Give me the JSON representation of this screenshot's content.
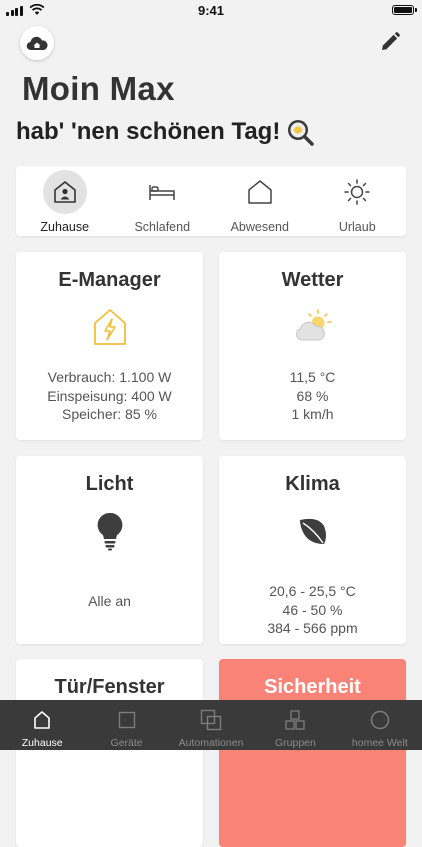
{
  "statusbar": {
    "time": "9:41"
  },
  "header": {
    "greeting": "Moin Max",
    "subgreeting": "hab' 'nen schönen Tag!"
  },
  "modes": [
    {
      "label": "Zuhause",
      "icon": "home-person-icon",
      "active": true
    },
    {
      "label": "Schlafend",
      "icon": "bed-icon",
      "active": false
    },
    {
      "label": "Abwesend",
      "icon": "house-outline-icon",
      "active": false
    },
    {
      "label": "Urlaub",
      "icon": "sun-icon",
      "active": false
    }
  ],
  "cards": {
    "emanager": {
      "title": "E-Manager",
      "icon": "lightning-house-icon",
      "lines": [
        "Verbrauch: 1.100 W",
        "Einspeisung: 400 W",
        "Speicher: 85 %"
      ]
    },
    "wetter": {
      "title": "Wetter",
      "icon": "sun-cloud-icon",
      "lines": [
        "11,5 °C",
        "68 %",
        "1 km/h"
      ]
    },
    "licht": {
      "title": "Licht",
      "icon": "lightbulb-icon",
      "lines": [
        "Alle an"
      ]
    },
    "klima": {
      "title": "Klima",
      "icon": "leaf-icon",
      "lines": [
        "20,6 - 25,5 °C",
        "46 - 50 %",
        "384 - 566 ppm"
      ]
    },
    "tuer": {
      "title": "Tür/Fenster"
    },
    "sicherheit": {
      "title": "Sicherheit",
      "color": "#fa8378"
    }
  },
  "bottomnav": [
    {
      "label": "Zuhause",
      "icon": "home-icon",
      "active": true
    },
    {
      "label": "Geräte",
      "icon": "square-icon",
      "active": false
    },
    {
      "label": "Automationen",
      "icon": "stacked-squares-icon",
      "active": false
    },
    {
      "label": "Gruppen",
      "icon": "grid-squares-icon",
      "active": false
    },
    {
      "label": "homee Welt",
      "icon": "circle-icon",
      "active": false
    }
  ]
}
